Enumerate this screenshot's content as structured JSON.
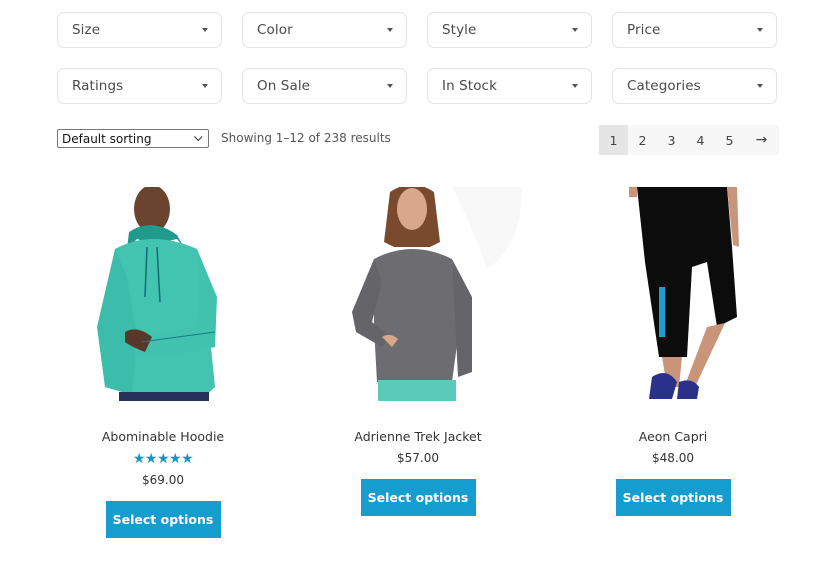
{
  "filters": [
    {
      "label": "Size",
      "icon": "caret-down-icon"
    },
    {
      "label": "Color",
      "icon": "caret-down-icon"
    },
    {
      "label": "Style",
      "icon": "caret-down-icon"
    },
    {
      "label": "Price",
      "icon": "caret-down-icon"
    },
    {
      "label": "Ratings",
      "icon": "caret-down-icon"
    },
    {
      "label": "On Sale",
      "icon": "caret-down-icon"
    },
    {
      "label": "In Stock",
      "icon": "caret-down-icon"
    },
    {
      "label": "Categories",
      "icon": "caret-down-icon"
    }
  ],
  "toolbar": {
    "sort_selected": "Default sorting",
    "result_count": "Showing 1–12 of 238 results"
  },
  "pagination": {
    "pages": [
      "1",
      "2",
      "3",
      "4",
      "5"
    ],
    "current": "1",
    "next_label": "→"
  },
  "products": [
    {
      "title": "Abominable Hoodie",
      "rating_stars": "★★★★★",
      "rating": 5,
      "price": "$69.00",
      "button": "Select options",
      "image": "teal hoodie model"
    },
    {
      "title": "Adrienne Trek Jacket",
      "price": "$57.00",
      "button": "Select options",
      "image": "grey half-zip jacket model"
    },
    {
      "title": "Aeon Capri",
      "price": "$48.00",
      "button": "Select options",
      "image": "black capri leggings model"
    }
  ],
  "colors": {
    "accent": "#159dcf",
    "star": "#1a94c4"
  }
}
